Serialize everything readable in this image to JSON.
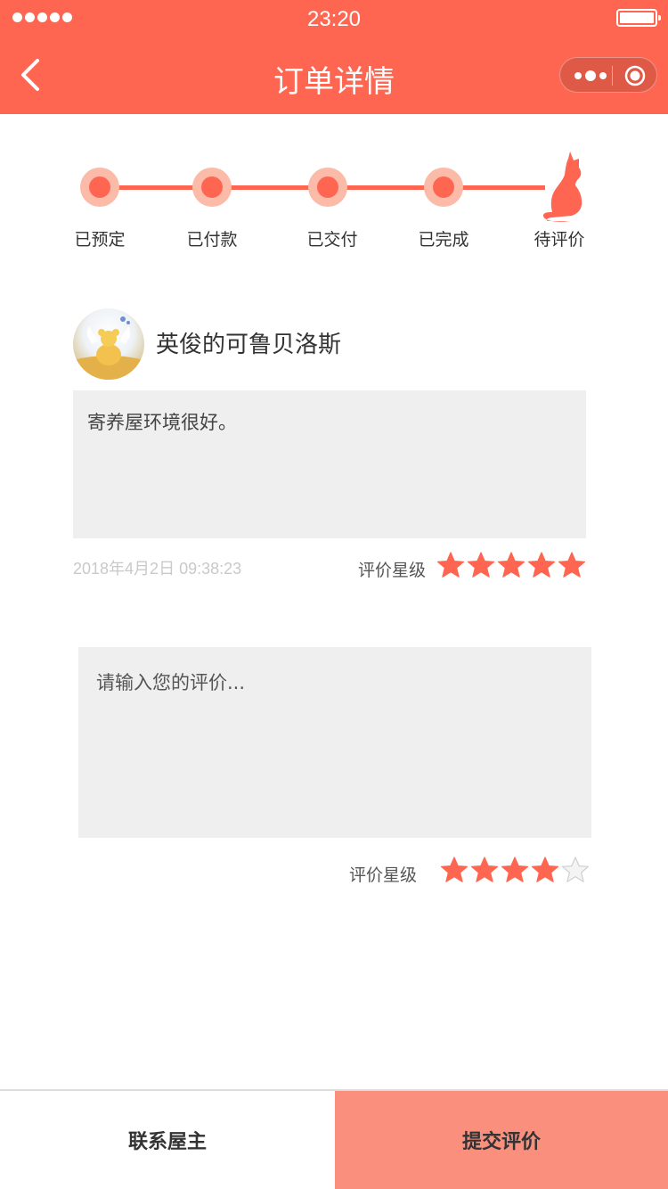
{
  "status_bar": {
    "time": "23:20",
    "signal_dots": 5,
    "battery": "full"
  },
  "nav": {
    "title": "订单详情",
    "back_icon": "chevron-left-icon",
    "more_icon": "more-dots-icon",
    "close_icon": "record-circle-icon"
  },
  "colors": {
    "accent": "#fe6651",
    "accent_light": "#fcbaa9",
    "submit_bg": "#f98f7c",
    "box_bg": "#efefef"
  },
  "progress": {
    "steps": [
      {
        "label": "已预定"
      },
      {
        "label": "已付款"
      },
      {
        "label": "已交付"
      },
      {
        "label": "已完成"
      },
      {
        "label": "待评价"
      }
    ],
    "current_icon": "cat-icon"
  },
  "review": {
    "username": "英俊的可鲁贝洛斯",
    "text": "寄养屋环境很好。",
    "time": "2018年4月2日 09:38:23",
    "rating_label": "评价星级",
    "rating": 5,
    "max_rating": 5
  },
  "new_review": {
    "placeholder": "请输入您的评价...",
    "value": "",
    "rating_label": "评价星级",
    "rating": 4,
    "max_rating": 5
  },
  "actions": {
    "contact_label": "联系屋主",
    "submit_label": "提交评价"
  }
}
